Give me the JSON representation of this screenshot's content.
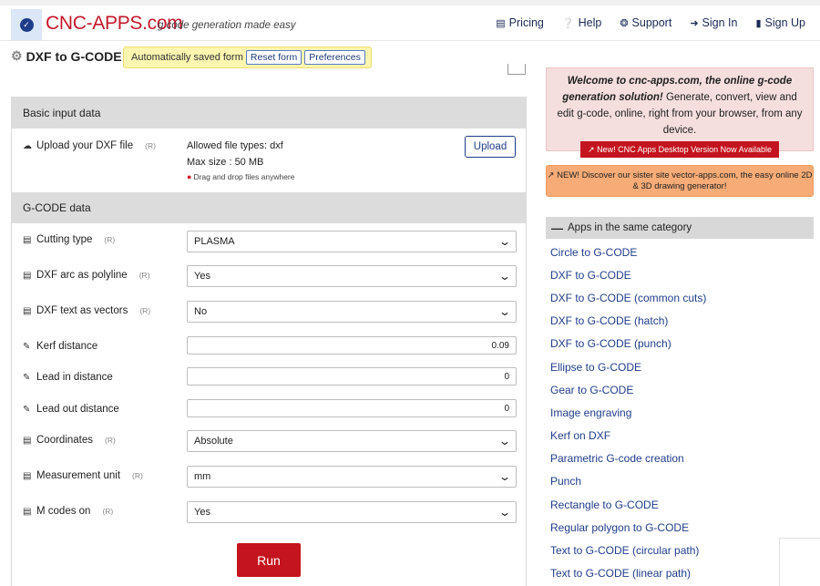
{
  "nav": {
    "brand": "CNC-APPS.com",
    "tagline": "g code generation made easy",
    "links": [
      {
        "icon": "credit-card-icon",
        "label": "Pricing"
      },
      {
        "icon": "help-icon",
        "label": "Help"
      },
      {
        "icon": "lifebuoy-icon",
        "label": "Support"
      },
      {
        "icon": "sign-in-icon",
        "label": "Sign In"
      },
      {
        "icon": "clipboard-icon",
        "label": "Sign Up"
      }
    ]
  },
  "page": {
    "title": "DXF to G-CODE",
    "autosave_text": "Automatically saved form",
    "reset_label": "Reset form",
    "preferences_label": "Preferences"
  },
  "basic": {
    "heading": "Basic input data",
    "upload_label": "Upload your DXF file",
    "required_mark": "(R)",
    "allowed_types": "Allowed file types: dxf",
    "max_size": "Max size : 50 MB",
    "drag_hint": "Drag and drop files anywhere",
    "upload_button": "Upload"
  },
  "gcode": {
    "heading": "G-CODE data",
    "cutting_type": {
      "label": "Cutting type",
      "r": "(R)",
      "value": "PLASMA"
    },
    "arc_polyline": {
      "label": "DXF arc as polyline",
      "r": "(R)",
      "value": "Yes"
    },
    "text_vectors": {
      "label": "DXF text as vectors",
      "r": "(R)",
      "value": "No"
    },
    "kerf": {
      "label": "Kerf distance",
      "value": "0.09"
    },
    "lead_in": {
      "label": "Lead in distance",
      "value": "0"
    },
    "lead_out": {
      "label": "Lead out distance",
      "value": "0"
    },
    "coordinates": {
      "label": "Coordinates",
      "r": "(R)",
      "value": "Absolute"
    },
    "unit": {
      "label": "Measurement unit",
      "r": "(R)",
      "value": "mm"
    },
    "m_codes": {
      "label": "M codes on",
      "r": "(R)",
      "value": "Yes"
    },
    "run_label": "Run"
  },
  "sidebar": {
    "welcome_bold": "Welcome to cnc-apps.com, the online g-code generation solution!",
    "welcome_text": " Generate, convert, view and edit g-code, online, right from your browser, from any device.",
    "desktop_button": "New! CNC Apps Desktop Version Now Available",
    "sister_text": "NEW! Discover our sister site vector-apps.com, the easy online 2D & 3D drawing generator!",
    "category_heading": "Apps in the same category",
    "apps": [
      "Circle to G-CODE",
      "DXF to G-CODE",
      "DXF to G-CODE (common cuts)",
      "DXF to G-CODE (hatch)",
      "DXF to G-CODE (punch)",
      "Ellipse to G-CODE",
      "Gear to G-CODE",
      "Image engraving",
      "Kerf on DXF",
      "Parametric G-code creation",
      "Punch",
      "Rectangle to G-CODE",
      "Regular polygon to G-CODE",
      "Text to G-CODE (circular path)",
      "Text to G-CODE (linear path)"
    ]
  }
}
